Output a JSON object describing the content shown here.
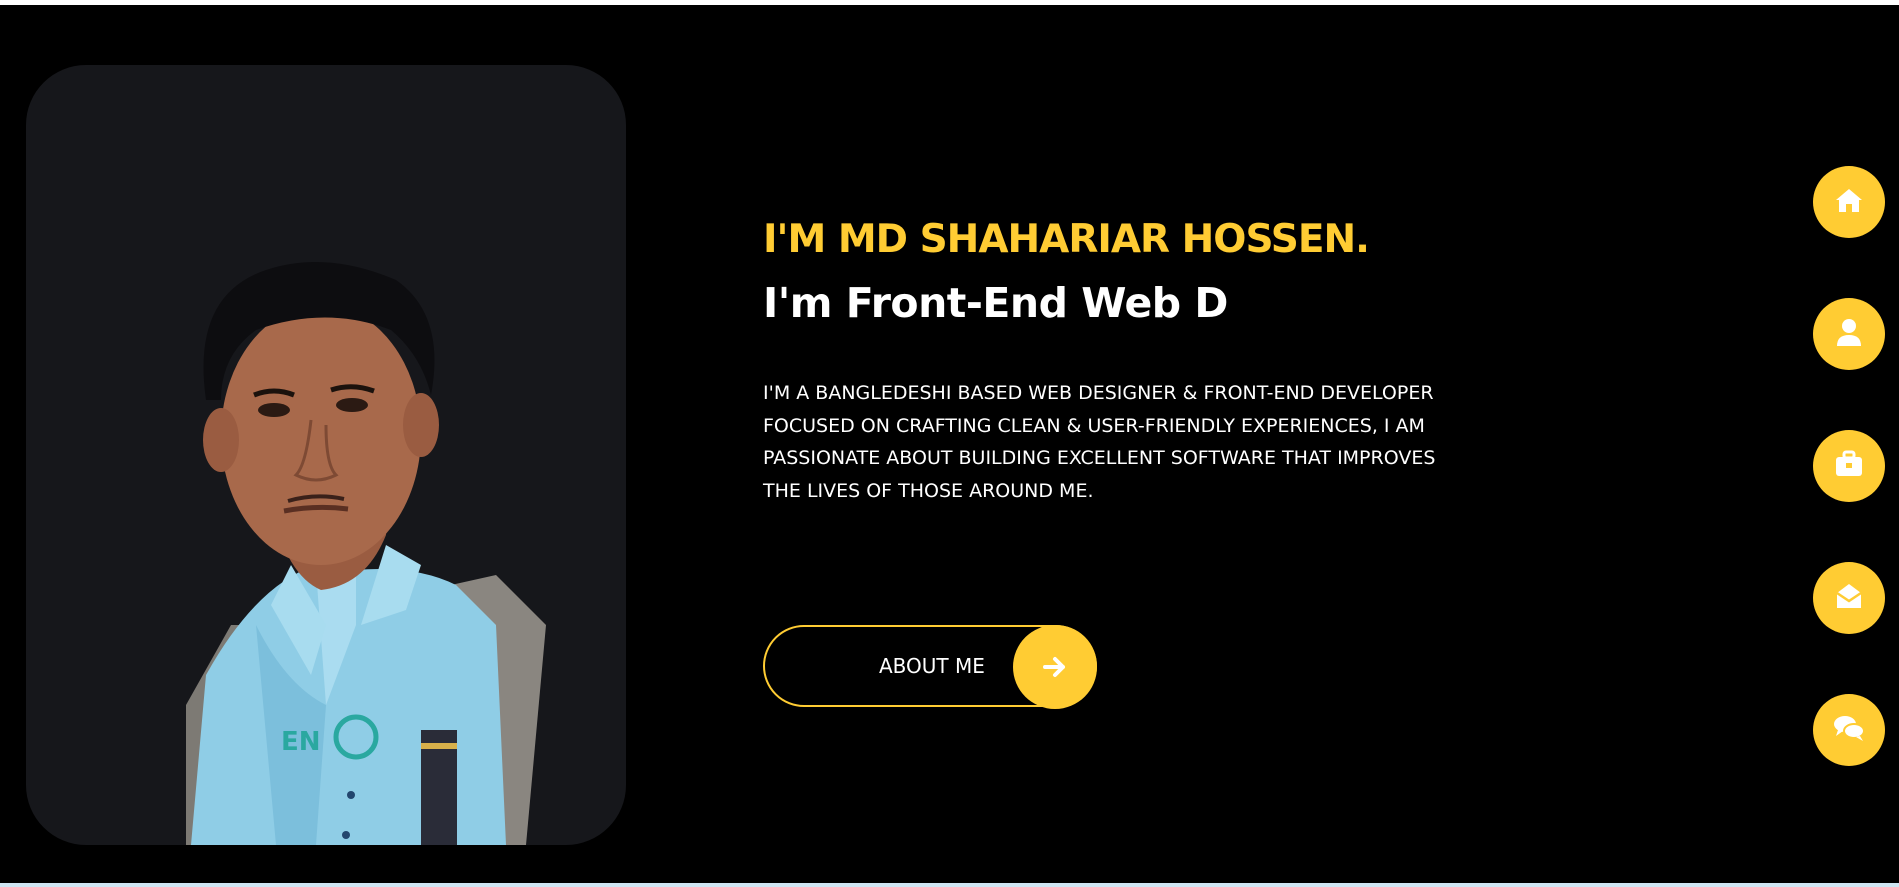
{
  "hero": {
    "greeting": "I'M MD SHAHARIAR HOSSEN.",
    "role_typed": "I'm Front-End Web D",
    "bio_lines": [
      "I'M A BANGLEDESHI BASED WEB DESIGNER & FRONT-END DEVELOPER",
      "FOCUSED ON CRAFTING CLEAN & USER-FRIENDLY EXPERIENCES, I AM",
      "PASSIONATE ABOUT BUILDING EXCELLENT SOFTWARE THAT IMPROVES",
      "THE LIVES OF THOSE AROUND ME."
    ],
    "about_button": {
      "label": "ABOUT ME",
      "icon": "arrow-right-icon"
    },
    "photo": {
      "subject": "portrait-photo"
    }
  },
  "side_nav": {
    "items": [
      {
        "icon": "home-icon"
      },
      {
        "icon": "user-icon"
      },
      {
        "icon": "briefcase-icon"
      },
      {
        "icon": "envelope-open-icon"
      },
      {
        "icon": "comments-icon"
      }
    ]
  },
  "colors": {
    "background": "#000000",
    "accent": "#ffcc33",
    "card": "#16171b",
    "text": "#ffffff"
  }
}
